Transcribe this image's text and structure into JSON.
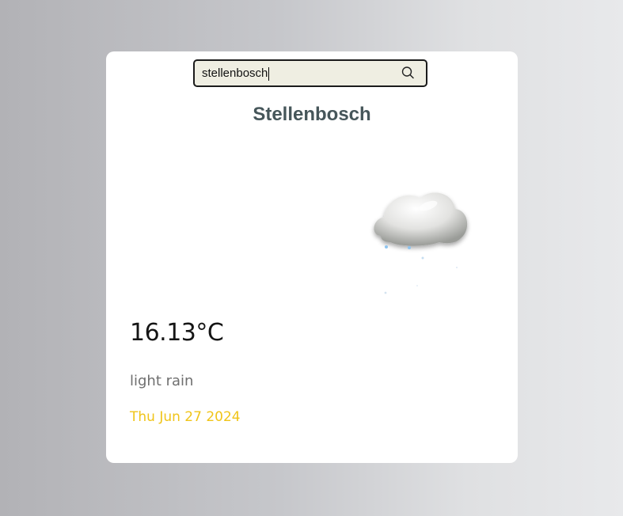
{
  "search": {
    "value": "stellenbosch",
    "icon": "search-icon"
  },
  "weather": {
    "city": "Stellenbosch",
    "icon": "light-rain-cloud-icon",
    "temperature": "16.13°C",
    "description": "light rain",
    "date": "Thu Jun 27 2024"
  },
  "colors": {
    "city": "#46565a",
    "date": "#f0c419",
    "search_bg": "#efeee2"
  }
}
